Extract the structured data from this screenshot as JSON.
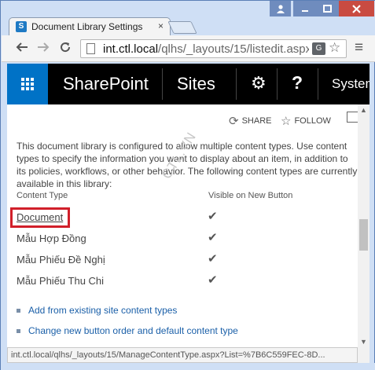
{
  "browser": {
    "tab_title": "Document Library Settings",
    "tab_close": "×",
    "url_host": "int.ctl.local",
    "url_path": "/qlhs/_layouts/15/listedit.aspx",
    "status_url": "int.ctl.local/qlhs/_layouts/15/ManageContentType.aspx?List=%7B6C559FEC-8D..."
  },
  "suite": {
    "brand": "SharePoint",
    "sites": "Sites",
    "help": "?",
    "system": "System"
  },
  "actions": {
    "share": "SHARE",
    "follow": "FOLLOW"
  },
  "content": {
    "description": "This document library is configured to allow multiple content types. Use content types to specify the information you want to display about an item, in addition to its policies, workflows, or other behavior. The following content types are currently available in this library:",
    "col_content_type": "Content Type",
    "col_visible": "Visible on New Button",
    "rows": [
      {
        "name": "Document",
        "visible": "✔"
      },
      {
        "name": "Mẫu Hợp Đồng",
        "visible": "✔"
      },
      {
        "name": "Mẫu Phiếu Đề Nghị",
        "visible": "✔"
      },
      {
        "name": "Mẫu Phiếu Thu Chi",
        "visible": "✔"
      }
    ],
    "links": [
      "Add from existing site content types",
      "Change new button order and default content type"
    ],
    "watermark": "CTL.VN"
  },
  "icons": {
    "sp_logo": "S",
    "translate": "G"
  }
}
